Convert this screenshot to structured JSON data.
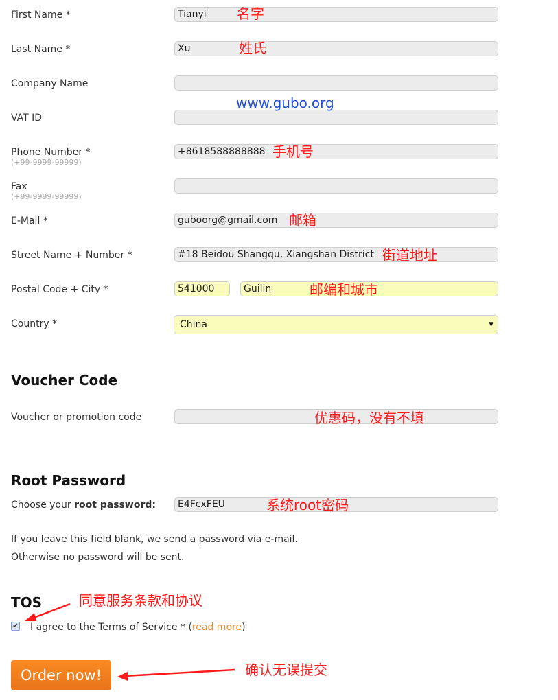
{
  "form": {
    "fields": [
      {
        "label": "First Name *",
        "value": "Tianyi",
        "annotation": "名字"
      },
      {
        "label": "Last Name *",
        "value": "Xu",
        "annotation": "姓氏"
      },
      {
        "label": "Company Name",
        "value": ""
      },
      {
        "label": "VAT ID",
        "value": ""
      },
      {
        "label": "Phone Number *",
        "hint": "(+99-9999-99999)",
        "value": "+8618588888888",
        "annotation": "手机号"
      },
      {
        "label": "Fax",
        "hint": "(+99-9999-99999)",
        "value": ""
      },
      {
        "label": "E-Mail *",
        "value": "guboorg@gmail.com",
        "annotation": "邮箱"
      },
      {
        "label": "Street Name + Number *",
        "value": "#18 Beidou Shangqu, Xiangshan District",
        "annotation": "街道地址"
      },
      {
        "label": "Postal Code + City *",
        "postal": "541000",
        "city": "Guilin",
        "annotation": "邮编和城市"
      },
      {
        "label": "Country *",
        "selected": "China"
      }
    ],
    "watermark": "www.gubo.org"
  },
  "voucher": {
    "heading": "Voucher Code",
    "label": "Voucher or promotion code",
    "value": "",
    "annotation": "优惠码，没有不填"
  },
  "root_password": {
    "heading": "Root Password",
    "label_prefix": "Choose your ",
    "label_bold": "root password:",
    "value": "E4FcxFEU",
    "annotation": "系统root密码",
    "note_line1": "If you leave this field blank, we send a password via e-mail.",
    "note_line2": "Otherwise no password will be sent."
  },
  "tos": {
    "heading": "TOS",
    "checked": true,
    "text": "I agree to the Terms of Service * (",
    "link": "read more",
    "text_end": ")",
    "annotation": "同意服务条款和协议"
  },
  "order": {
    "button_label": "Order now!",
    "annotation": "确认无误提交",
    "accent_color": "#f28a28"
  }
}
